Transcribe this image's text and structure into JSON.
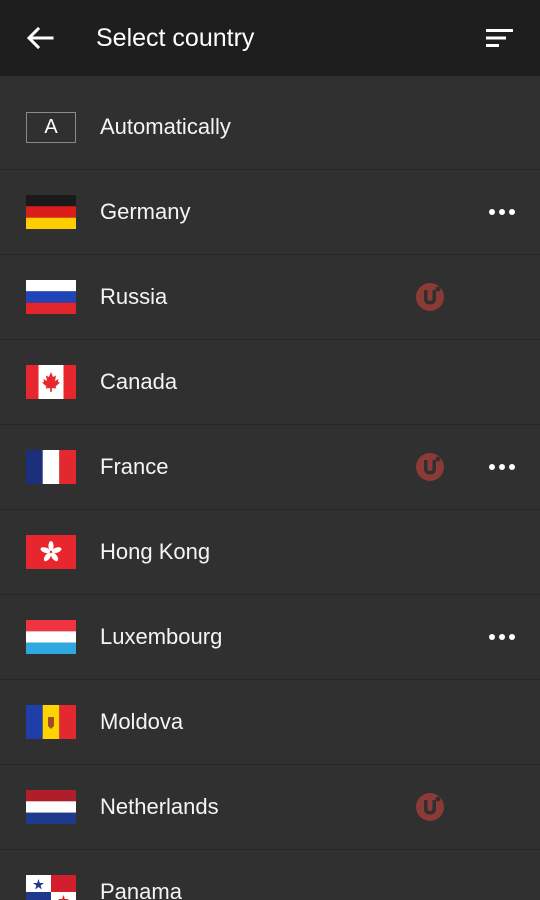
{
  "header": {
    "title": "Select country",
    "back_icon": "arrow-left-icon",
    "sort_icon": "sort-icon"
  },
  "countries": [
    {
      "name": "Automatically",
      "flag": "auto",
      "badge": "A",
      "torrent": false,
      "more": false
    },
    {
      "name": "Germany",
      "flag": "de",
      "torrent": false,
      "more": true
    },
    {
      "name": "Russia",
      "flag": "ru",
      "torrent": true,
      "more": false
    },
    {
      "name": "Canada",
      "flag": "ca",
      "torrent": false,
      "more": false
    },
    {
      "name": "France",
      "flag": "fr",
      "torrent": true,
      "more": true
    },
    {
      "name": "Hong Kong",
      "flag": "hk",
      "torrent": false,
      "more": false
    },
    {
      "name": "Luxembourg",
      "flag": "lu",
      "torrent": false,
      "more": true
    },
    {
      "name": "Moldova",
      "flag": "md",
      "torrent": false,
      "more": false
    },
    {
      "name": "Netherlands",
      "flag": "nl",
      "torrent": true,
      "more": false
    },
    {
      "name": "Panama",
      "flag": "pa",
      "torrent": false,
      "more": false
    }
  ],
  "colors": {
    "background": "#303030",
    "appbar": "#1e1e1e",
    "torrent_icon": "#8b3a36",
    "text": "#f4f4f4"
  }
}
